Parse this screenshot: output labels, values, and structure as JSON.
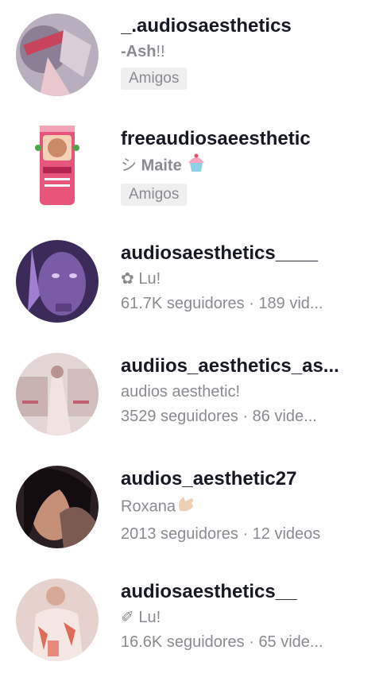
{
  "accounts": [
    {
      "username": "_.audiosaesthetics",
      "nickname_bold": "-Ash",
      "nickname_rest": "!!",
      "badge": "Amigos"
    },
    {
      "username": "freeaudiosaeesthetic",
      "nickname_prefix": "シ",
      "nickname_bold": "Maite",
      "nickname_emoji": "cupcake-icon",
      "badge": "Amigos"
    },
    {
      "username": "audiosaesthetics____",
      "nickname_prefix": "✿",
      "nickname": "Lu!",
      "stats": "61.7K seguidores · 189 vid..."
    },
    {
      "username": "audiios_aesthetics_as...",
      "nickname": "audios aesthetic!",
      "stats": "3529 seguidores · 86 vide..."
    },
    {
      "username": "audios_aesthetic27",
      "nickname": "Roxana",
      "nickname_emoji": "hand-icon",
      "stats": "2013 seguidores · 12 videos"
    },
    {
      "username": "audiosaesthetics__",
      "nickname_prefix": "✐",
      "nickname": "Lu!",
      "stats": "16.6K seguidores · 65 vide..."
    }
  ]
}
